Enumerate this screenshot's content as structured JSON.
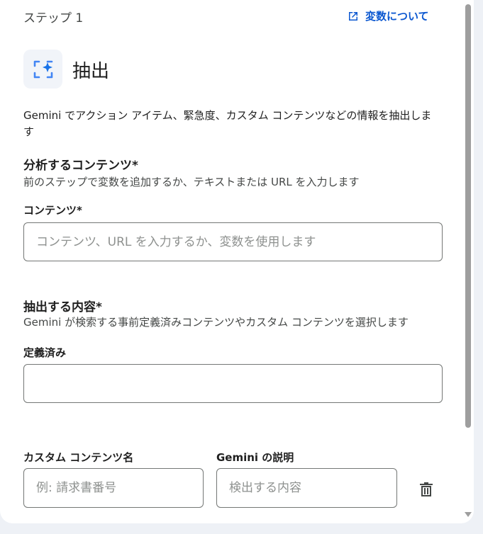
{
  "header": {
    "step_label": "ステップ 1",
    "about_variables_link": "変数について",
    "title": "抽出"
  },
  "description": "Gemini でアクション アイテム、緊急度、カスタム コンテンツなどの情報を抽出します",
  "analyze_section": {
    "title": "分析するコンテンツ*",
    "subtitle": "前のステップで変数を追加するか、テキストまたは URL を入力します",
    "content_label": "コンテンツ*",
    "content_placeholder": "コンテンツ、URL を入力するか、変数を使用します",
    "content_value": ""
  },
  "extract_section": {
    "title": "抽出する内容*",
    "subtitle": "Gemini が検索する事前定義済みコンテンツやカスタム コンテンツを選択します",
    "predefined_label": "定義済み",
    "predefined_value": ""
  },
  "custom_content": {
    "name_label": "カスタム コンテンツ名",
    "name_placeholder": "例: 請求書番号",
    "description_label": "Gemini の説明",
    "description_placeholder": "検出する内容"
  },
  "icons": {
    "hero": "extract-sparkle-icon",
    "link": "open-in-new-icon",
    "delete": "trash-icon"
  },
  "colors": {
    "accent": "#0b57d0",
    "icon_blue": "#4285f4"
  }
}
